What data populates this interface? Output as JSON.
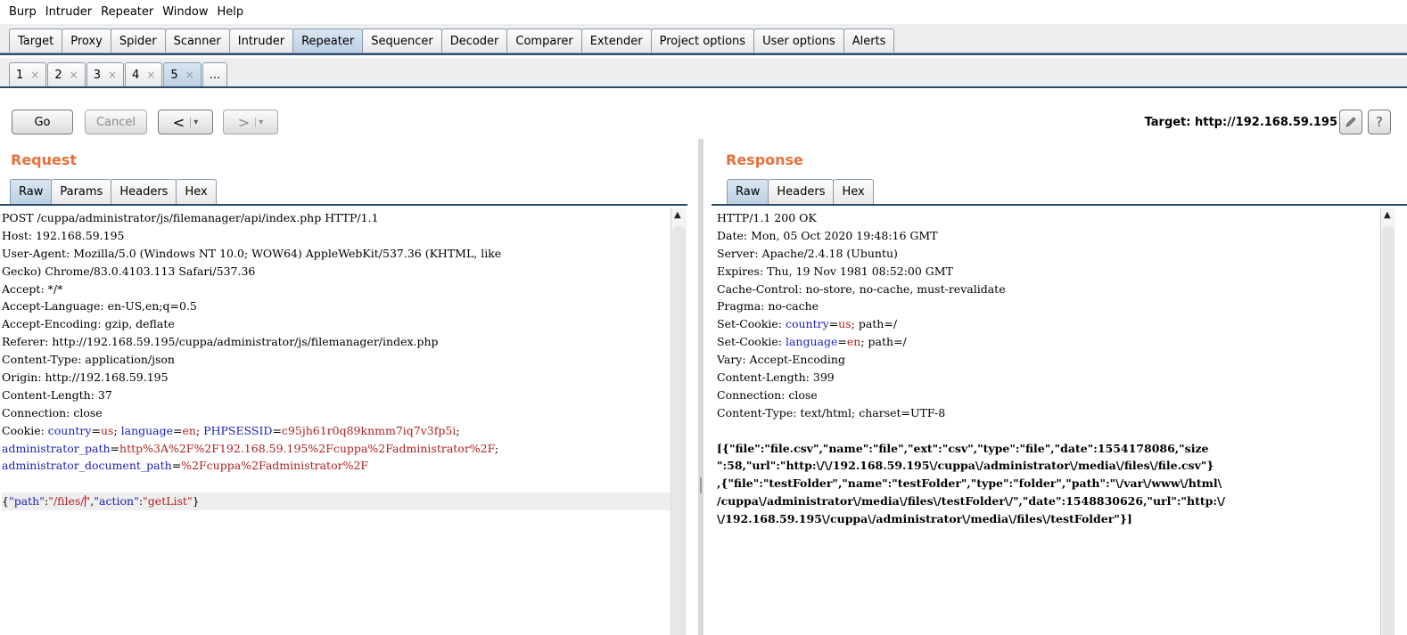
{
  "menu": [
    "Burp",
    "Intruder",
    "Repeater",
    "Window",
    "Help"
  ],
  "main_tabs": [
    {
      "label": "Target",
      "active": false
    },
    {
      "label": "Proxy",
      "active": false
    },
    {
      "label": "Spider",
      "active": false
    },
    {
      "label": "Scanner",
      "active": false
    },
    {
      "label": "Intruder",
      "active": false
    },
    {
      "label": "Repeater",
      "active": true
    },
    {
      "label": "Sequencer",
      "active": false
    },
    {
      "label": "Decoder",
      "active": false
    },
    {
      "label": "Comparer",
      "active": false
    },
    {
      "label": "Extender",
      "active": false
    },
    {
      "label": "Project options",
      "active": false
    },
    {
      "label": "User options",
      "active": false
    },
    {
      "label": "Alerts",
      "active": false
    }
  ],
  "repeater_tabs": [
    {
      "label": "1",
      "close": "×"
    },
    {
      "label": "2",
      "close": "×"
    },
    {
      "label": "3",
      "close": "×"
    },
    {
      "label": "4",
      "close": "×"
    },
    {
      "label": "5",
      "close": "×",
      "active": true
    }
  ],
  "more_tabs_label": "...",
  "toolbar": {
    "go": "Go",
    "cancel": "Cancel",
    "back": "<",
    "forward": ">",
    "dropdown": "▾",
    "target": "Target: http://192.168.59.195"
  },
  "request": {
    "title": "Request",
    "tabs": [
      "Raw",
      "Params",
      "Headers",
      "Hex"
    ],
    "lines": [
      "POST /cuppa/administrator/js/filemanager/api/index.php HTTP/1.1",
      "Host: 192.168.59.195",
      "User-Agent: Mozilla/5.0 (Windows NT 10.0; WOW64) AppleWebKit/537.36 (KHTML, like",
      "Gecko) Chrome/83.0.4103.113 Safari/537.36",
      "Accept: */*",
      "Accept-Language: en-US,en;q=0.5",
      "Accept-Encoding: gzip, deflate",
      "Referer: http://192.168.59.195/cuppa/administrator/js/filemanager/index.php",
      "Content-Type: application/json",
      "Origin: http://192.168.59.195",
      "Content-Length: 37",
      "Connection: close"
    ],
    "cookie": {
      "prefix": "Cookie: ",
      "k1": "country",
      "v1": "us",
      "k2": "language",
      "v2": "en",
      "k3": "PHPSESSID",
      "v3": "c95jh61r0q89knmm7iq7v3fp5i",
      "k4": "administrator_path",
      "v4": "http%3A%2F%2F192.168.59.195%2Fcuppa%2Fadministrator%2F",
      "k5": "administrator_document_path",
      "v5": "%2Fcuppa%2Fadministrator%2F"
    },
    "body": {
      "open": "{",
      "k1": "\"path\"",
      "v1a": "\"/files/",
      "v1b": "\"",
      "k2": "\"action\"",
      "v2": "\"getList\"",
      "close": "}"
    }
  },
  "response": {
    "title": "Response",
    "tabs": [
      "Raw",
      "Headers",
      "Hex"
    ],
    "lines_a": [
      "HTTP/1.1 200 OK",
      "Date: Mon, 05 Oct 2020 19:48:16 GMT",
      "Server: Apache/2.4.18 (Ubuntu)",
      "Expires: Thu, 19 Nov 1981 08:52:00 GMT",
      "Cache-Control: no-store, no-cache, must-revalidate",
      "Pragma: no-cache"
    ],
    "setcookie1": {
      "prefix": "Set-Cookie: ",
      "k": "country",
      "v": "us",
      "suffix": "; path=/"
    },
    "setcookie2": {
      "prefix": "Set-Cookie: ",
      "k": "language",
      "v": "en",
      "suffix": "; path=/"
    },
    "lines_b": [
      "Vary: Accept-Encoding",
      "Content-Length: 399",
      "Connection: close",
      "Content-Type: text/html; charset=UTF-8"
    ],
    "body_lines": [
      "[{\"file\":\"file.csv\",\"name\":\"file\",\"ext\":\"csv\",\"type\":\"file\",\"date\":1554178086,\"size",
      "\":58,\"url\":\"http:\\/\\/192.168.59.195\\/cuppa\\/administrator\\/media\\/files\\/file.csv\"}",
      ",{\"file\":\"testFolder\",\"name\":\"testFolder\",\"type\":\"folder\",\"path\":\"\\/var\\/www\\/html\\",
      "/cuppa\\/administrator\\/media\\/files\\/testFolder\\/\",\"date\":1548830626,\"url\":\"http:\\/",
      "\\/192.168.59.195\\/cuppa\\/administrator\\/media\\/files\\/testFolder\"}]"
    ]
  }
}
